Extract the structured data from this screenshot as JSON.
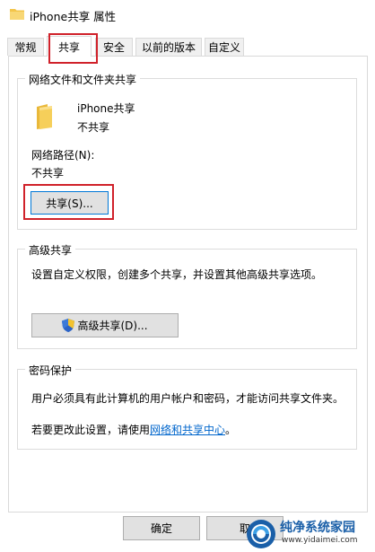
{
  "window": {
    "title": "iPhone共享 属性"
  },
  "tabs": [
    {
      "label": "常规"
    },
    {
      "label": "共享",
      "active": true
    },
    {
      "label": "安全"
    },
    {
      "label": "以前的版本"
    },
    {
      "label": "自定义"
    }
  ],
  "network_sharing": {
    "group_title": "网络文件和文件夹共享",
    "folder_name": "iPhone共享",
    "share_status": "不共享",
    "path_label": "网络路径(N):",
    "path_value": "不共享",
    "share_button": "共享(S)..."
  },
  "advanced_sharing": {
    "group_title": "高级共享",
    "description": "设置自定义权限，创建多个共享，并设置其他高级共享选项。",
    "button": "高级共享(D)..."
  },
  "password_protection": {
    "group_title": "密码保护",
    "description": "用户必须具有此计算机的用户帐户和密码，才能访问共享文件夹。",
    "change_prefix": "若要更改此设置，请使用",
    "change_link": "网络和共享中心",
    "change_suffix": "。"
  },
  "footer": {
    "ok_button": "确定",
    "cancel_button_partial": "取"
  },
  "watermark": {
    "brand": "纯净系统家园",
    "url": "www.yidaimei.com"
  },
  "colors": {
    "highlight_box": "#d0212a",
    "link": "#0066cc",
    "folder": "#f3c54a"
  }
}
